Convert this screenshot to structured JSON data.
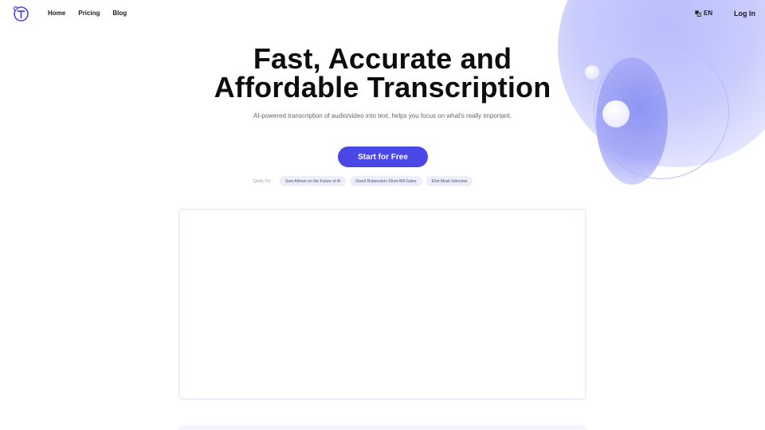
{
  "nav": {
    "home": "Home",
    "pricing": "Pricing",
    "blog": "Blog"
  },
  "header": {
    "lang": "EN",
    "login": "Log In"
  },
  "hero": {
    "title_line1": "Fast, Accurate and",
    "title_line2": "Affordable Transcription",
    "subtitle": "AI-powered transcription of audio/video into text, helps you focus on what's really important.",
    "cta": "Start for Free"
  },
  "quick_try": {
    "label": "Quick Try :",
    "items": [
      "Sam Altman on the Future of AI",
      "David Rubenstein Show Bill Gates",
      "Elon Musk Interview"
    ]
  },
  "colors": {
    "accent": "#4a47e6",
    "chip_bg": "#eceefa"
  },
  "icons": {
    "logo": "t-logo-icon",
    "lang": "translate-icon"
  }
}
